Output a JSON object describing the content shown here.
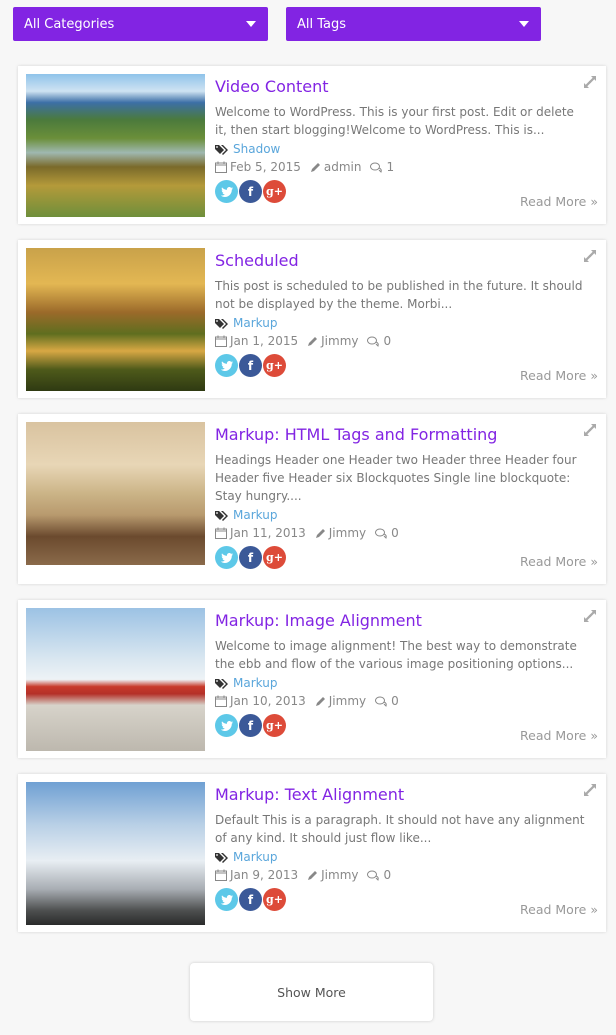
{
  "filters": {
    "categories": "All Categories",
    "tags": "All Tags"
  },
  "colors": {
    "accent": "#8224e3",
    "tag_link": "#5aa6db",
    "twitter": "#5dc8e8",
    "facebook": "#3b5998",
    "google_plus": "#dd4b39"
  },
  "posts": [
    {
      "title": "Video Content",
      "excerpt": "Welcome to WordPress. This is your first post. Edit or delete it, then start blogging!Welcome to WordPress. This is...",
      "tag": "Shadow",
      "date": "Feb 5, 2015",
      "author": "admin",
      "comments": "1",
      "image": "rice-terraces-landscape",
      "read_more": "Read More »"
    },
    {
      "title": "Scheduled",
      "excerpt": "This post is scheduled to be published in the future. It should not be displayed by the theme. Morbi...",
      "tag": "Markup",
      "date": "Jan 1, 2015",
      "author": "Jimmy",
      "comments": "0",
      "image": "autumn-village-stream",
      "read_more": "Read More »"
    },
    {
      "title": "Markup: HTML Tags and Formatting",
      "excerpt": "Headings Header one Header two Header three Header four Header five Header six Blockquotes Single line blockquote: Stay hungry....",
      "tag": "Markup",
      "date": "Jan 11, 2013",
      "author": "Jimmy",
      "comments": "0",
      "image": "living-room-interior",
      "read_more": "Read More »"
    },
    {
      "title": "Markup: Image Alignment",
      "excerpt": "Welcome to image alignment! The best way to demonstrate the ebb and flow of the various image positioning options...",
      "tag": "Markup",
      "date": "Jan 10, 2013",
      "author": "Jimmy",
      "comments": "0",
      "image": "red-airplane",
      "read_more": "Read More »"
    },
    {
      "title": "Markup: Text Alignment",
      "excerpt": "Default This is a paragraph. It should not have any alignment of any kind. It should just flow like...",
      "tag": "Markup",
      "date": "Jan 9, 2013",
      "author": "Jimmy",
      "comments": "0",
      "image": "eiffel-tower",
      "read_more": "Read More »"
    }
  ],
  "show_more": "Show More"
}
